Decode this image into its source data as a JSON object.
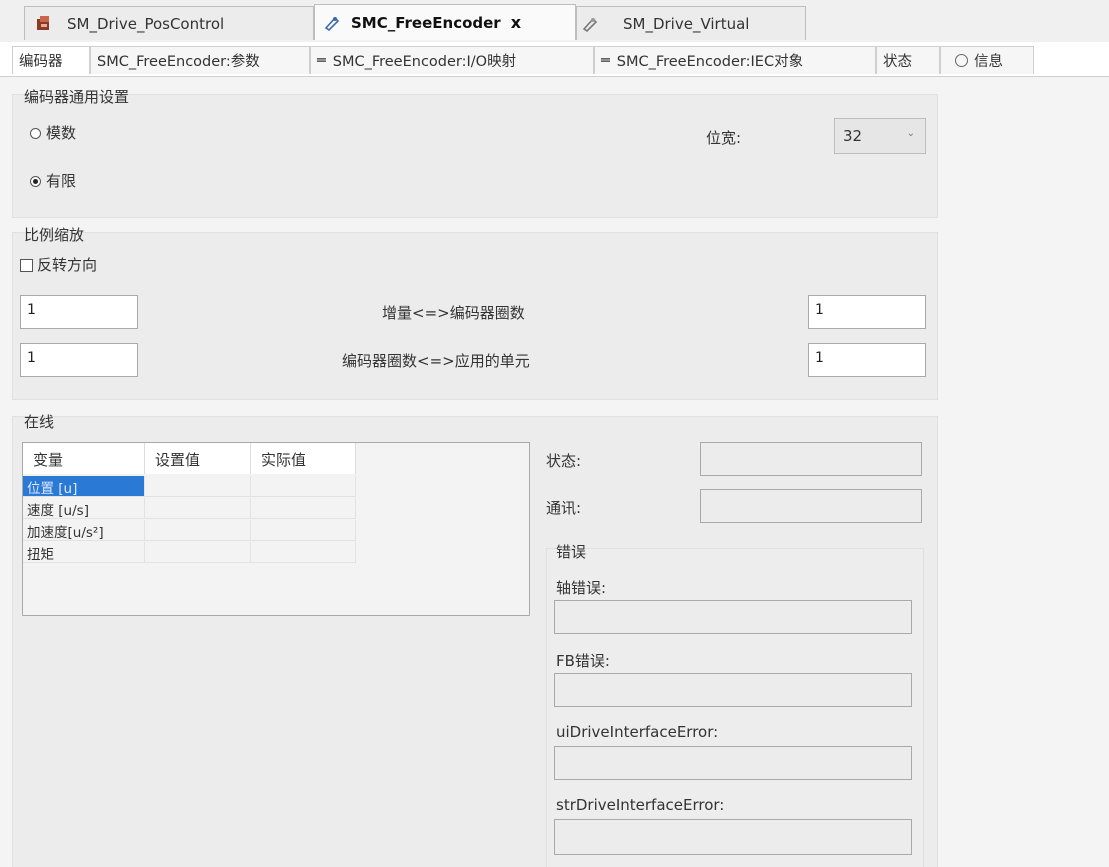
{
  "editor_tabs": [
    {
      "label": "SM_Drive_PosControl",
      "icon": "drive-icon",
      "active": false
    },
    {
      "label": "SMC_FreeEncoder",
      "icon": "encoder-icon",
      "active": true,
      "close": "x"
    },
    {
      "label": "SM_Drive_Virtual",
      "icon": "encoder-icon",
      "active": false
    }
  ],
  "sub_tabs": [
    {
      "label": "编码器",
      "active": true
    },
    {
      "label": "SMC_FreeEncoder:参数"
    },
    {
      "label": "SMC_FreeEncoder:I/O映射",
      "icon": "mapping-icon"
    },
    {
      "label": "SMC_FreeEncoder:IEC对象",
      "icon": "mapping-icon"
    },
    {
      "label": "状态"
    },
    {
      "label": "信息",
      "icon": "info-icon"
    }
  ],
  "general": {
    "title": "编码器通用设置",
    "modulo_label": "模数",
    "finite_label": "有限",
    "selected": "finite",
    "bitwidth_label": "位宽:",
    "bitwidth_value": "32"
  },
  "scaling": {
    "title": "比例缩放",
    "invert_label": "反转方向",
    "invert_checked": false,
    "row1": {
      "left": "1",
      "label": "增量<=>编码器圈数",
      "right": "1"
    },
    "row2": {
      "left": "1",
      "label": "编码器圈数<=>应用的单元",
      "right": "1"
    }
  },
  "online": {
    "title": "在线",
    "columns": [
      "变量",
      "设置值",
      "实际值"
    ],
    "rows": [
      {
        "name": "位置 [u]",
        "set": "",
        "actual": "",
        "selected": true
      },
      {
        "name": "速度 [u/s]",
        "set": "",
        "actual": ""
      },
      {
        "name": "加速度[u/s²]",
        "set": "",
        "actual": ""
      },
      {
        "name": "扭矩",
        "set": "",
        "actual": ""
      }
    ],
    "status_label": "状态:",
    "status_value": "",
    "comm_label": "通讯:",
    "comm_value": "",
    "errors": {
      "title": "错误",
      "axis_error_label": "轴错误:",
      "axis_error_value": "",
      "fb_error_label": "FB错误:",
      "fb_error_value": "",
      "ui_drive_error_label": "uiDriveInterfaceError:",
      "ui_drive_error_value": "",
      "str_drive_error_label": "strDriveInterfaceError:",
      "str_drive_error_value": ""
    }
  },
  "colors": {
    "selection": "#2a7ad5",
    "panel": "#ececec",
    "background": "#f4f4f4"
  }
}
